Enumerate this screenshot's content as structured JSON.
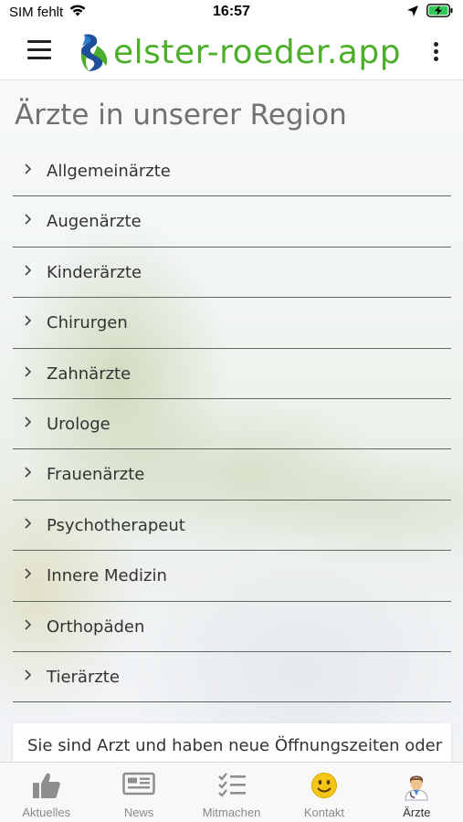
{
  "status_bar": {
    "carrier": "SIM fehlt",
    "time": "16:57"
  },
  "header": {
    "app_name": "elster-roeder.app",
    "brand_color": "#4cae2a"
  },
  "main": {
    "title": "Ärzte in unserer Region",
    "categories": [
      {
        "label": "Allgemeinärzte"
      },
      {
        "label": "Augenärzte"
      },
      {
        "label": "Kinderärzte"
      },
      {
        "label": "Chirurgen"
      },
      {
        "label": "Zahnärzte"
      },
      {
        "label": "Urologe"
      },
      {
        "label": "Frauenärzte"
      },
      {
        "label": "Psychotherapeut"
      },
      {
        "label": "Innere Medizin"
      },
      {
        "label": "Orthopäden"
      },
      {
        "label": "Tierärzte"
      }
    ],
    "info_text": "Sie sind Arzt und haben neue Öffnungszeiten oder"
  },
  "tabbar": {
    "tabs": [
      {
        "label": "Aktuelles",
        "icon": "thumbs-up-icon"
      },
      {
        "label": "News",
        "icon": "newspaper-icon"
      },
      {
        "label": "Mitmachen",
        "icon": "checklist-icon"
      },
      {
        "label": "Kontakt",
        "icon": "smiley-icon"
      },
      {
        "label": "Ärzte",
        "icon": "doctor-icon",
        "active": true
      }
    ]
  }
}
